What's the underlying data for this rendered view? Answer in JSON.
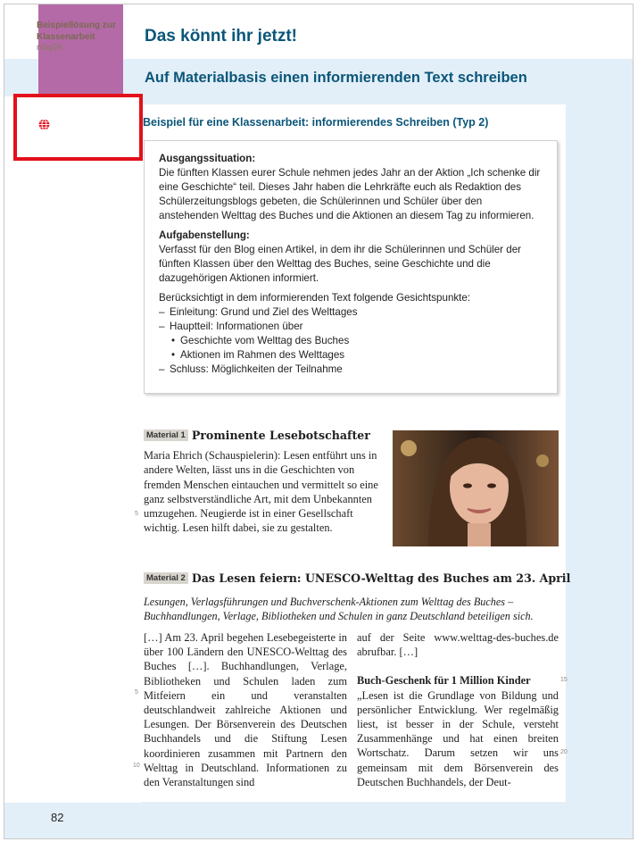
{
  "header": {
    "title": "Das könnt ihr jetzt!",
    "subtitle": "Auf Materialbasis einen informierenden Text schreiben"
  },
  "sidebar": {
    "icon": "globe-icon",
    "title": "Beispiellösung zur Klassenarbeit",
    "code": "n4qi2k"
  },
  "task": {
    "heading": "Beispiel für eine Klassenarbeit: informierendes Schreiben (Typ 2)",
    "situation_label": "Ausgangssituation:",
    "situation_text": "Die fünften Klassen eurer Schule nehmen jedes Jahr an der Aktion „Ich schenke dir eine Geschichte“ teil. Dieses Jahr haben die Lehrkräfte euch als Redaktion des Schülerzeitungsblogs gebeten, die Schülerinnen und Schüler über den anstehenden Welttag des Buches und die Aktionen an diesem Tag zu informieren.",
    "assignment_label": "Aufgabenstellung:",
    "assignment_text": "Verfasst für den Blog einen Artikel, in dem ihr die Schülerinnen und Schüler der fünften Klassen über den Welttag des Buches, seine Geschichte und die dazugehörigen Aktionen informiert.",
    "criteria_intro": "Berücksichtigt in dem informierenden Text folgende Gesichtspunkte:",
    "criteria": [
      "Einleitung: Grund und Ziel des Welttages",
      "Hauptteil: Informationen über",
      "Geschichte vom Welttag des Buches",
      "Aktionen im Rahmen des Welttages",
      "Schluss: Möglichkeiten der Teilnahme"
    ]
  },
  "material1": {
    "badge": "Material 1",
    "title": "Prominente Lesebotschafter",
    "text": "Maria Ehrich (Schauspielerin): Lesen entführt uns in andere Welten, lässt uns in die Geschichten von fremden Menschen eintauchen und vermittelt so eine ganz selbstverständliche Art, mit dem Unbekannten umzugehen. Neugierde ist in einer Gesellschaft wichtig. Lesen hilft dabei, sie zu gestalten."
  },
  "material2": {
    "badge": "Material 2",
    "title": "Das Lesen feiern: UNESCO-Welttag des Buches am 23. April",
    "subtitle": "Lesungen, Verlagsführungen und Buchverschenk-Aktionen zum Welttag des Buches – Buchhandlungen, Verlage, Bibliotheken und Schulen in ganz Deutschland beteiligen sich.",
    "col_left": "[…] Am 23. April begehen Lesebegeisterte in über 100 Ländern den UNESCO-Welttag des Buches […]. Buchhandlungen, Verlage, Bibliotheken und Schulen laden zum Mitfeiern ein und veranstalten deutschlandweit zahlreiche Aktionen und Lesungen. Der Börsenverein des Deutschen Buchhandels und die Stiftung Lesen koordinieren zusammen mit Partnern den Welttag in Deutschland. Informationen zu den Veranstaltungen sind",
    "col_right_1": "auf der Seite www.welttag-des-buches.de abrufbar. […]",
    "col_right_heading": "Buch-Geschenk für 1 Million Kinder",
    "col_right_2": "„Lesen ist die Grundlage von Bildung und persönlicher Entwicklung. Wer regelmäßig liest, ist besser in der Schule, versteht Zusammenhänge und hat einen breiten Wortschatz. Darum setzen wir uns gemeinsam mit dem Börsenverein des Deutschen Buchhandels, der Deut-"
  },
  "line_numbers": {
    "m1_5": "5",
    "m2_5": "5",
    "m2_10": "10",
    "m2_15": "15",
    "m2_20": "20"
  },
  "footer": {
    "page_number": "82"
  },
  "colors": {
    "heading_blue": "#0a5679",
    "purple_tab": "#b46aa6",
    "band_blue": "#e3eff8",
    "highlight_red": "#e3101b"
  }
}
